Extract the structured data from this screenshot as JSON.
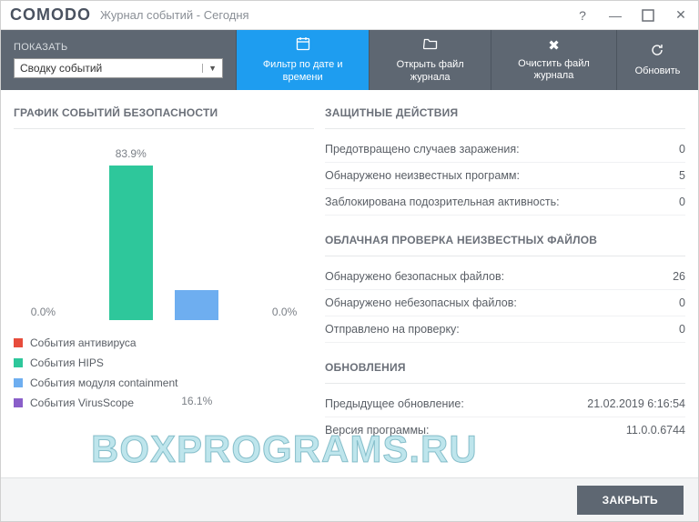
{
  "titlebar": {
    "logo": "COMODO",
    "title": "Журнал событий - Сегодня"
  },
  "toolbar": {
    "show_label": "ПОКАЗАТЬ",
    "select_value": "Сводку событий",
    "filter_label": "Фильтр по дате и времени",
    "open_label": "Открыть файл журнала",
    "clear_label": "Очистить файл журнала",
    "refresh_label": "Обновить"
  },
  "chart": {
    "title": "ГРАФИК СОБЫТИЙ БЕЗОПАСНОСТИ",
    "legend": {
      "av": "События антивируса",
      "hips": "События HIPS",
      "containment": "События модуля containment",
      "vs": "События VirusScope"
    }
  },
  "chart_data": {
    "type": "bar",
    "categories": [
      "События антивируса",
      "События HIPS",
      "События модуля containment",
      "События VirusScope"
    ],
    "values": [
      0.0,
      83.9,
      16.1,
      0.0
    ],
    "labels": [
      "0.0%",
      "83.9%",
      "16.1%",
      "0.0%"
    ],
    "colors": [
      "#e74c3c",
      "#2ec79b",
      "#6eaef0",
      "#8a5fc9"
    ],
    "ylim": [
      0,
      100
    ],
    "title": "ГРАФИК СОБЫТИЙ БЕЗОПАСНОСТИ"
  },
  "sections": {
    "defense": {
      "title": "ЗАЩИТНЫЕ ДЕЙСТВИЯ",
      "rows": [
        {
          "label": "Предотвращено случаев заражения:",
          "value": "0"
        },
        {
          "label": "Обнаружено неизвестных программ:",
          "value": "5"
        },
        {
          "label": "Заблокирована подозрительная активность:",
          "value": "0"
        }
      ]
    },
    "cloud": {
      "title": "ОБЛАЧНАЯ ПРОВЕРКА НЕИЗВЕСТНЫХ ФАЙЛОВ",
      "rows": [
        {
          "label": "Обнаружено безопасных файлов:",
          "value": "26"
        },
        {
          "label": "Обнаружено небезопасных файлов:",
          "value": "0"
        },
        {
          "label": "Отправлено на проверку:",
          "value": "0"
        }
      ]
    },
    "updates": {
      "title": "ОБНОВЛЕНИЯ",
      "rows": [
        {
          "label": "Предыдущее обновление:",
          "value": "21.02.2019 6:16:54"
        },
        {
          "label": "Версия программы:",
          "value": "11.0.0.6744"
        }
      ]
    }
  },
  "footer": {
    "close": "ЗАКРЫТЬ"
  },
  "watermark": "BOXPROGRAMS.RU"
}
